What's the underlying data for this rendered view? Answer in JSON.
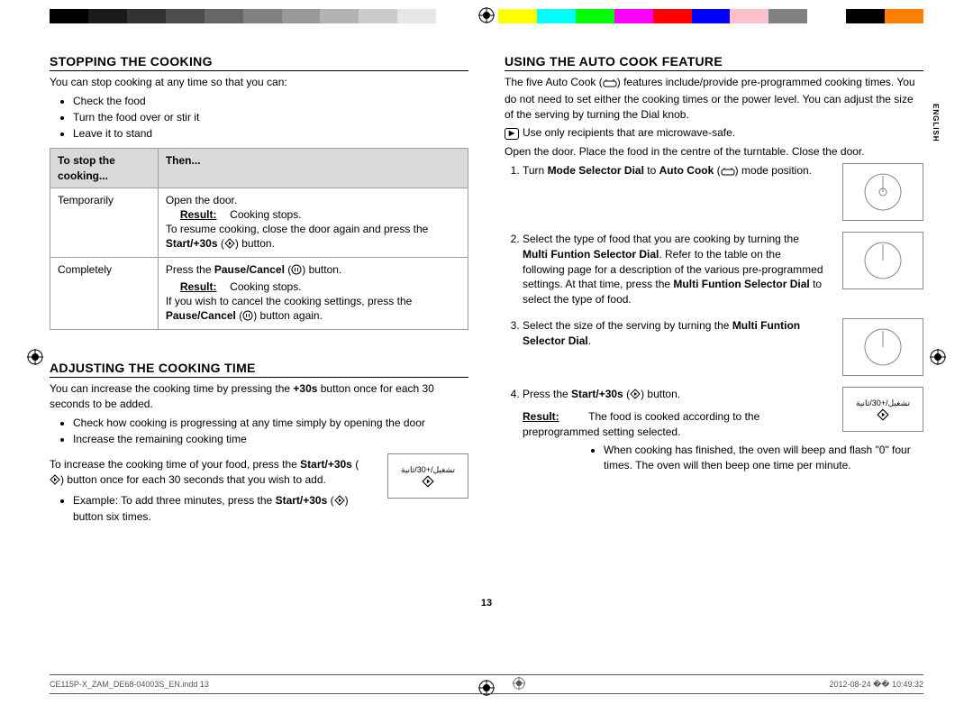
{
  "colorbar": [
    "#000000",
    "#1a1a1a",
    "#333333",
    "#4d4d4d",
    "#666666",
    "#808080",
    "#999999",
    "#b3b3b3",
    "#cccccc",
    "#e6e6e6",
    "#ffffff",
    "#ffffff",
    "#ffffff",
    "#ffffff",
    "#ffff00",
    "#00ffff",
    "#00ff00",
    "#ff00ff",
    "#ff0000",
    "#0000ff",
    "#ffc0cb",
    "#808080",
    "#ffffff",
    "#000000",
    "#ff8000"
  ],
  "side_label": "ENGLISH",
  "page_number": "13",
  "footer": {
    "left": "CE115P-X_ZAM_DE68-04003S_EN.indd   13",
    "right": "2012-08-24   �� 10:49:32"
  },
  "left": {
    "h1": "STOPPING THE COOKING",
    "intro": "You can stop cooking at any time so that you can:",
    "bullets": [
      "Check the food",
      "Turn the food over or stir it",
      "Leave it to stand"
    ],
    "table": {
      "head": [
        "To stop the cooking...",
        "Then..."
      ],
      "rows": [
        {
          "c1": "Temporarily",
          "l1": "Open the door.",
          "result_label": "Result:",
          "result_text": "Cooking stops.",
          "l3a": "To resume cooking, close the door again and press the ",
          "l3b": "Start/+30s",
          "l3c": " (",
          "l3d": ") button."
        },
        {
          "c1": "Completely",
          "l1a": "Press the ",
          "l1b": "Pause/Cancel",
          "l1c": " (",
          "l1d": ") button.",
          "result_label": "Result:",
          "result_text": "Cooking stops.",
          "l3a": "If you wish to cancel the cooking settings, press the ",
          "l3b": "Pause/Cancel",
          "l3c": " (",
          "l3d": ") button again."
        }
      ]
    },
    "h2": "ADJUSTING THE COOKING TIME",
    "p2a": "You can increase the cooking time by pressing the ",
    "p2b": "+30s",
    "p2c": " button once for each 30 seconds to be added.",
    "bullets2": [
      "Check how cooking is progressing at any time simply by opening the door",
      "Increase the remaining cooking time"
    ],
    "p3a": "To increase the cooking time of your food, press the ",
    "p3b": "Start/+30s",
    "p3c": " (",
    "p3d": ") button once for each 30 seconds that you wish to add.",
    "ex_a": "Example: To add three minutes, press the ",
    "ex_b": "Start/+30s",
    "ex_c": " (",
    "ex_d": ") button six times.",
    "btn_label": "تشغيل/+30/ثانية"
  },
  "right": {
    "h1": "USING THE AUTO COOK FEATURE",
    "p1a": "The five Auto Cook (",
    "p1b": ") features include/provide pre-programmed cooking times. You do not need to set either the cooking times or the power level. You can adjust the size of the serving by turning the Dial knob.",
    "note": "Use only recipients that are microwave-safe.",
    "p2": "Open the door. Place the food in the centre of the turntable. Close the door.",
    "steps": [
      {
        "a": "Turn ",
        "b": "Mode Selector Dial",
        "c": " to ",
        "d": "Auto Cook",
        "e": " (",
        "f": ") mode position."
      },
      {
        "a": "Select the type of food that you are cooking by turning the ",
        "b": "Multi Funtion Selector Dial",
        "c": ". Refer to the table on the following page for a description of the various pre-programmed settings. At that time, press the ",
        "d": "Multi Funtion Selector Dial",
        "e": " to select the type of food."
      },
      {
        "a": "Select the size of the serving by turning the ",
        "b": "Multi Funtion Selector Dial",
        "c": "."
      },
      {
        "a": "Press the ",
        "b": "Start/+30s",
        "c": " (",
        "d": ") button."
      }
    ],
    "result_label": "Result:",
    "result_text": "The food is cooked according to the preprogrammed setting selected.",
    "result_b1": "When cooking has finished, the oven will beep and flash \"0\" four times. The oven will then beep one time per minute.",
    "btn_label": "تشغيل/+30/ثانية"
  }
}
